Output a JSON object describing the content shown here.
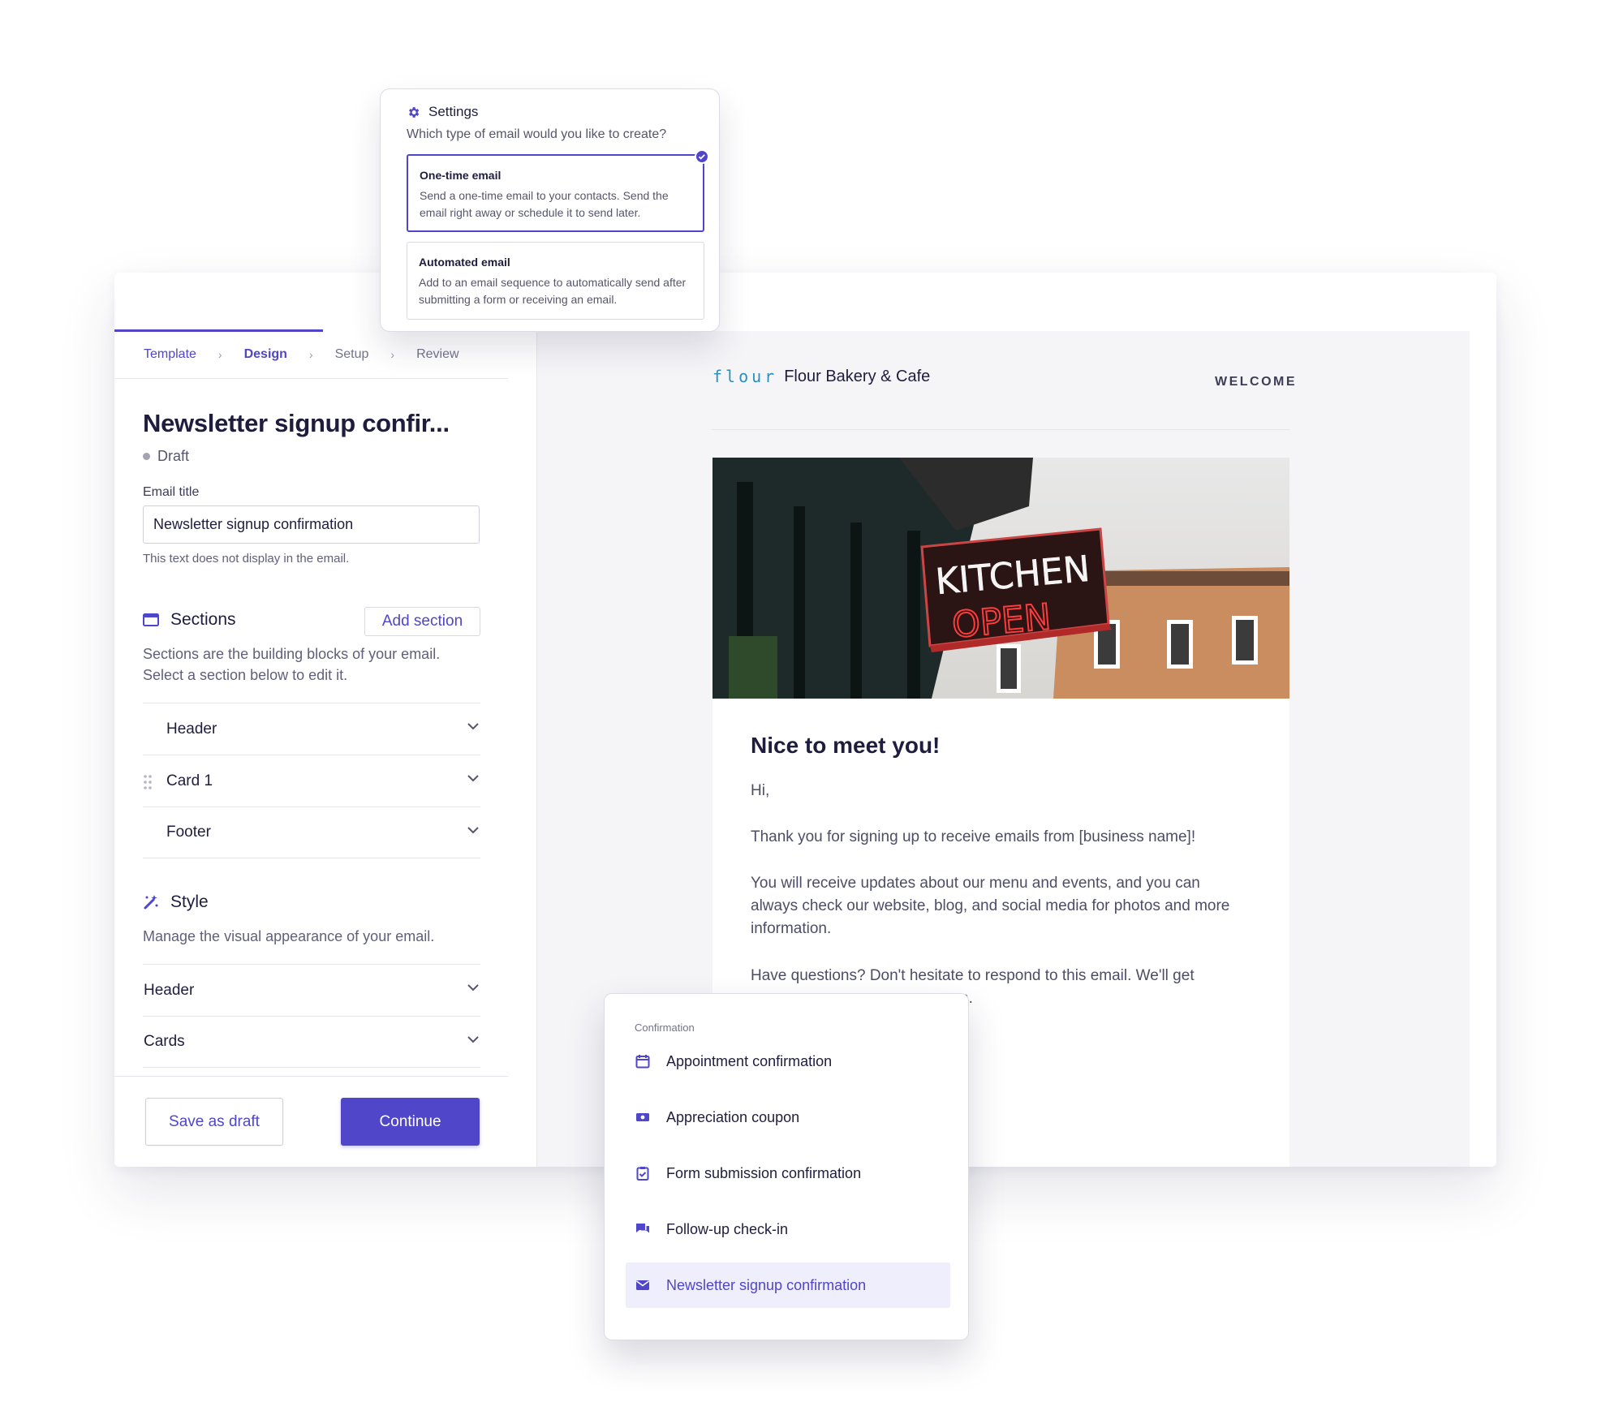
{
  "steps": {
    "template": "Template",
    "design": "Design",
    "setup": "Setup",
    "review": "Review",
    "separator": "›"
  },
  "editor": {
    "title": "Newsletter signup confir...",
    "status": "Draft",
    "email_title_label": "Email title",
    "email_title_value": "Newsletter signup confirmation",
    "email_title_help": "This text does not display in the email."
  },
  "sections": {
    "heading": "Sections",
    "add_label": "Add section",
    "desc_line1": "Sections are the building blocks of your email.",
    "desc_line2": "Select a section below to edit it.",
    "items": [
      {
        "label": "Header"
      },
      {
        "label": "Card 1"
      },
      {
        "label": "Footer"
      }
    ]
  },
  "style": {
    "heading": "Style",
    "desc": "Manage the visual appearance of your email.",
    "items": [
      {
        "label": "Header"
      },
      {
        "label": "Cards"
      }
    ]
  },
  "footer_buttons": {
    "save_draft": "Save as draft",
    "continue": "Continue"
  },
  "preview": {
    "logo_word": "flour",
    "brand": "Flour Bakery & Cafe",
    "welcome": "WELCOME",
    "hero_sign_line1": "KITCHEN",
    "hero_sign_line2": "OPEN",
    "card_title": "Nice to meet you!",
    "p1": "Hi,",
    "p2": "Thank you for signing up to receive emails from [business name]!",
    "p3": "You will receive updates about our menu and events, and you can always check our website, blog, and social media for photos and more information.",
    "p4_line1": "Have questions? Don't hesitate to respond to this email. We'll get",
    "p4_line2": "n."
  },
  "settings": {
    "title": "Settings",
    "question": "Which type of email would you like to create?",
    "options": [
      {
        "title": "One-time email",
        "desc": "Send a one-time email to your contacts. Send the email right away or schedule it to send later.",
        "selected": true
      },
      {
        "title": "Automated email",
        "desc": "Add to an email sequence to automatically send after submitting a form or receiving an email.",
        "selected": false
      }
    ]
  },
  "confirmation_menu": {
    "category": "Confirmation",
    "items": [
      {
        "label": "Appointment confirmation",
        "icon": "calendar-icon"
      },
      {
        "label": "Appreciation coupon",
        "icon": "ticket-icon"
      },
      {
        "label": "Form submission confirmation",
        "icon": "clipboard-check-icon"
      },
      {
        "label": "Follow-up check-in",
        "icon": "chat-bubbles-icon"
      },
      {
        "label": "Newsletter signup confirmation",
        "icon": "envelope-icon",
        "selected": true
      }
    ]
  },
  "colors": {
    "accent": "#4f46c9",
    "text": "#1f1d3d",
    "muted": "#60607a",
    "preview_bg": "#f5f5f8"
  }
}
